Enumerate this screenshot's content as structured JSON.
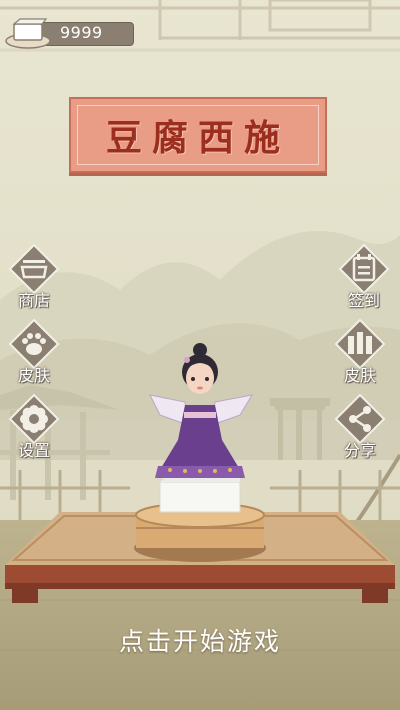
{
  "hud": {
    "coins": "9999"
  },
  "title": "豆腐西施",
  "buttons": {
    "shop": "商店",
    "skin_left": "皮肤",
    "settings": "设置",
    "checkin": "签到",
    "skin_right": "皮肤",
    "share": "分享"
  },
  "start_prompt": "点击开始游戏",
  "colors": {
    "background": "#e6e3cf",
    "plaque": "#e99d86",
    "title_text": "#9c2e20",
    "button_fill": "#8a7f70",
    "stage_wood": "#c9a27a",
    "floor": "#b5aa86"
  },
  "icons": {
    "shop": "shop-icon",
    "skin_left": "paw-icon",
    "settings": "gear-icon",
    "checkin": "calendar-icon",
    "skin_right": "wardrobe-icon",
    "share": "share-icon"
  }
}
